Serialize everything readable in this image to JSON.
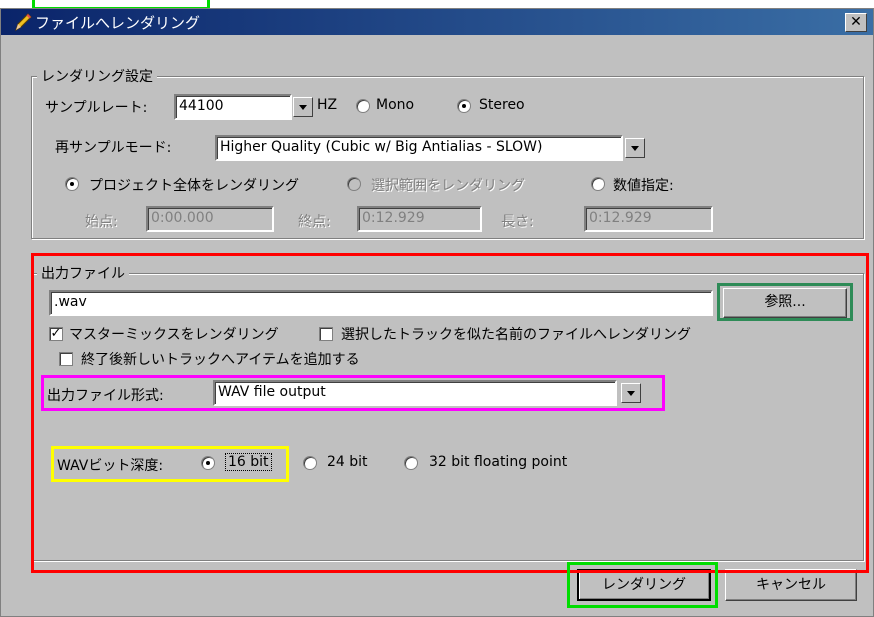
{
  "top_strip_text": "",
  "window": {
    "title": "ファイルへレンダリング",
    "close_glyph": "✕",
    "icon": "pencil-icon"
  },
  "render_settings": {
    "legend": "レンダリング設定",
    "sample_rate_label": "サンプルレート:",
    "sample_rate_value": "44100",
    "hz_label": "HZ",
    "mono_label": "Mono",
    "stereo_label": "Stereo",
    "channel_selected": "Stereo",
    "resample_label": "再サンプルモード:",
    "resample_value": "Higher Quality (Cubic w/ Big Antialias - SLOW)",
    "range_project_label": "プロジェクト全体をレンダリング",
    "range_selection_label": "選択範囲をレンダリング",
    "range_numeric_label": "数値指定:",
    "range_selected": "project",
    "start_label": "始点:",
    "start_value": "0:00.000",
    "end_label": "終点:",
    "end_value": "0:12.929",
    "length_label": "長さ:",
    "length_value": "0:12.929"
  },
  "output_file": {
    "legend": "出力ファイル",
    "filename": ".wav",
    "browse_label": "参照...",
    "master_mix_label": "マスターミックスをレンダリング",
    "master_mix_checked": true,
    "selected_tracks_label": "選択したトラックを似た名前のファイルへレンダリング",
    "selected_tracks_checked": false,
    "add_items_label": "終了後新しいトラックへアイテムを追加する",
    "add_items_checked": false,
    "format_label": "出力ファイル形式:",
    "format_value": "WAV file output",
    "bit_depth_label": "WAVビット深度:",
    "bit_16_label": "16 bit",
    "bit_24_label": "24 bit",
    "bit_32_label": "32 bit floating point",
    "bit_selected": "16 bit"
  },
  "buttons": {
    "render_label": "レンダリング",
    "cancel_label": "キャンセル"
  },
  "colors": {
    "highlight_red": "#ff0000",
    "highlight_green_light": "#00dd00",
    "highlight_green_dark": "#2e8b57",
    "highlight_magenta": "#ff00ff",
    "highlight_yellow": "#ffff00",
    "dialog_face": "#c0c0c0",
    "titlebar": "#0a246a"
  }
}
